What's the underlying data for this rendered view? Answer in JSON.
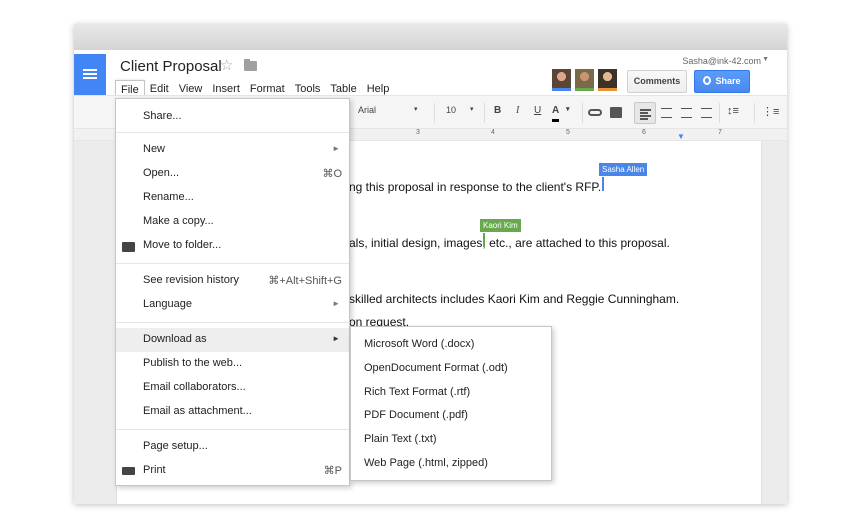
{
  "header": {
    "title": "Client Proposal",
    "user_email": "Sasha@ink-42.com",
    "comments_label": "Comments",
    "share_label": "Share"
  },
  "menubar": [
    "File",
    "Edit",
    "View",
    "Insert",
    "Format",
    "Tools",
    "Table",
    "Help"
  ],
  "toolbar": {
    "font": "Arial",
    "size": "10",
    "bold": "B",
    "italic": "I",
    "underline": "U",
    "text_color": "A"
  },
  "ruler": [
    "3",
    "4",
    "5",
    "6",
    "7"
  ],
  "document": {
    "line1": "ng this proposal in response to the client's RFP.",
    "line2": "als, initial design, images, etc., are attached to this proposal.",
    "line3": "skilled architects includes Kaori Kim and Reggie Cunningham.",
    "line4": "on request."
  },
  "collaborators": [
    {
      "name": "Sasha Allen",
      "color": "#4a86e8"
    },
    {
      "name": "Kaori Kim",
      "color": "#6aa84f"
    }
  ],
  "file_menu": {
    "share": "Share...",
    "new": "New",
    "open": "Open...",
    "open_shortcut": "⌘O",
    "rename": "Rename...",
    "make_copy": "Make a copy...",
    "move_to_folder": "Move to folder...",
    "revision_history": "See revision history",
    "revision_shortcut": "⌘+Alt+Shift+G",
    "language": "Language",
    "download_as": "Download as",
    "publish": "Publish to the web...",
    "email_collaborators": "Email collaborators...",
    "email_attachment": "Email as attachment...",
    "page_setup": "Page setup...",
    "print": "Print",
    "print_shortcut": "⌘P"
  },
  "download_submenu": [
    "Microsoft Word (.docx)",
    "OpenDocument Format (.odt)",
    "Rich Text Format (.rtf)",
    "PDF Document (.pdf)",
    "Plain Text (.txt)",
    "Web Page (.html, zipped)"
  ],
  "colors": {
    "docs_blue": "#4285f4",
    "share_blue": "#4a88f0"
  }
}
